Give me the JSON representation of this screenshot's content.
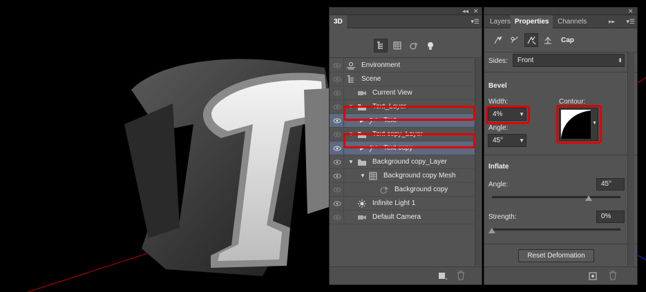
{
  "panel3d": {
    "strip_collapse": "◂◂",
    "strip_close": "✕",
    "tab": "3D",
    "menu": "▾☰",
    "filter_tools": [
      "scene-icon",
      "mesh-icon",
      "material-icon",
      "light-icon"
    ],
    "rows": [
      {
        "label": "Environment",
        "icon": "environment-icon",
        "arrow": ""
      },
      {
        "label": "Scene",
        "icon": "scene-icon",
        "arrow": ""
      },
      {
        "label": "Current View",
        "icon": "camera-icon",
        "arrow": ""
      },
      {
        "label": "Text_Layer",
        "icon": "folder-icon",
        "arrow": "▼"
      },
      {
        "label": "Text",
        "icon": "material-icon",
        "arrow": "▶"
      },
      {
        "label": "Text copy_Layer",
        "icon": "folder-icon",
        "arrow": "▼"
      },
      {
        "label": "Text copy",
        "icon": "material-icon",
        "arrow": "▶"
      },
      {
        "label": "Background copy_Layer",
        "icon": "folder-icon",
        "arrow": "▼"
      },
      {
        "label": "Background copy Mesh",
        "icon": "mesh-icon",
        "arrow": "▼"
      },
      {
        "label": "Background copy",
        "icon": "material-icon",
        "arrow": ""
      },
      {
        "label": "Infinite Light 1",
        "icon": "light-icon",
        "arrow": ""
      },
      {
        "label": "Default Camera",
        "icon": "camera-icon",
        "arrow": ""
      }
    ]
  },
  "props": {
    "strip_close": "✕",
    "tabs": [
      "Layers",
      "Properties",
      "Channels"
    ],
    "tab_more": "▸▸",
    "menu": "▾☰",
    "mode_title": "Cap",
    "sides_label": "Sides:",
    "sides_value": "Front",
    "bevel_title": "Bevel",
    "width_label": "Width:",
    "width_value": "4%",
    "contour_label": "Contour:",
    "angle_label": "Angle:",
    "angle_value": "45°",
    "inflate_title": "Inflate",
    "inflate_angle_label": "Angle:",
    "inflate_angle_value": "45°",
    "strength_label": "Strength:",
    "strength_value": "0%",
    "inflate_angle_fraction": 0.75,
    "strength_fraction": 0.0,
    "reset_label": "Reset Deformation"
  },
  "colors": {
    "highlight": "#e00000",
    "selection": "#5d6a80"
  }
}
